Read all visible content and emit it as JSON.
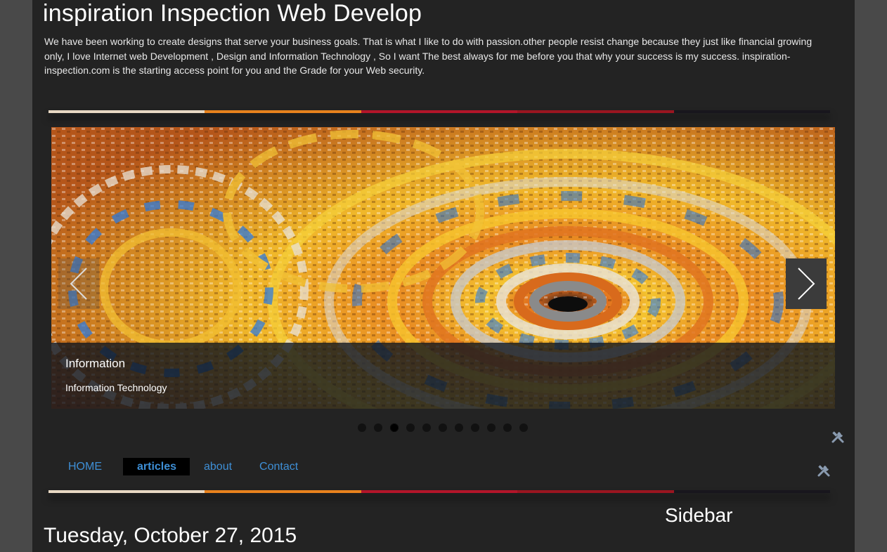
{
  "header": {
    "title": "inspiration Inspection Web Develop",
    "description": "We have been working to create designs that serve your business goals. That is what I like to do with passion.other people resist change because they just like financial growing only, I love Internet web Development , Design and Information Technology , So I want The best always for me before you that why your success is my success. inspiration-inspection.com is the starting access point for you and the Grade for your Web security."
  },
  "stripe_colors": [
    "#e8d8c3",
    "#e8821d",
    "#b3152a",
    "#9a1520",
    "#18161d"
  ],
  "slider": {
    "caption_title": "Information",
    "caption_text": "Information Technology",
    "prev_icon": "chevron-left-icon",
    "next_icon": "chevron-right-icon",
    "slide_count": 11,
    "active_slide": 3
  },
  "menu": {
    "items": [
      "HOME",
      "articles",
      "about",
      "Contact"
    ],
    "active": "articles"
  },
  "sidebar": {
    "title": "Sidebar"
  },
  "post": {
    "date": "Tuesday, October 27, 2015"
  },
  "colors": {
    "page_bg": "#232323",
    "outer_bg": "#494949",
    "link": "#3e8fd6"
  }
}
